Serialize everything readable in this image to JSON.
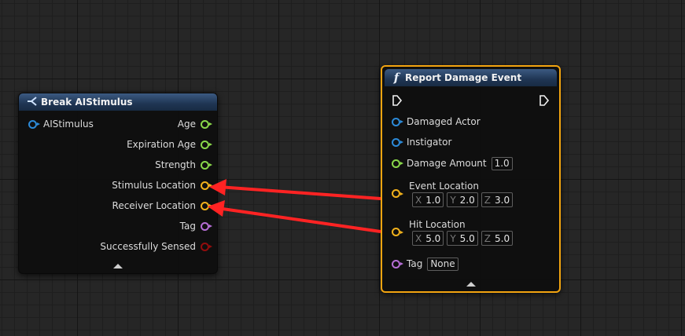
{
  "break_node": {
    "title": "Break AIStimulus",
    "input_label": "AIStimulus",
    "outputs": [
      {
        "label": "Age",
        "color": "#8ad84a"
      },
      {
        "label": "Expiration Age",
        "color": "#8ad84a"
      },
      {
        "label": "Strength",
        "color": "#8ad84a"
      },
      {
        "label": "Stimulus Location",
        "color": "#f2b21c"
      },
      {
        "label": "Receiver Location",
        "color": "#f2b21c"
      },
      {
        "label": "Tag",
        "color": "#b66ed6"
      },
      {
        "label": "Successfully Sensed",
        "color": "#930d0d"
      }
    ]
  },
  "report_node": {
    "title": "Report Damage Event",
    "inputs": {
      "damaged_actor": "Damaged Actor",
      "instigator": "Instigator",
      "damage_amount": "Damage Amount",
      "damage_amount_value": "1.0",
      "event_location": "Event Location",
      "event_location_x": "1.0",
      "event_location_y": "2.0",
      "event_location_z": "3.0",
      "hit_location": "Hit Location",
      "hit_location_x": "5.0",
      "hit_location_y": "5.0",
      "hit_location_z": "5.0",
      "tag": "Tag",
      "tag_value": "None"
    },
    "axis_labels": {
      "x": "X",
      "y": "Y",
      "z": "Z"
    }
  },
  "colors": {
    "object_pin": "#2c8ad8",
    "float_pin": "#8ad84a",
    "vector_pin": "#f2b21c",
    "name_pin": "#b66ed6",
    "bool_pin": "#930d0d",
    "selected_border": "#f2a410",
    "annotation_arrow": "#ff2323"
  }
}
